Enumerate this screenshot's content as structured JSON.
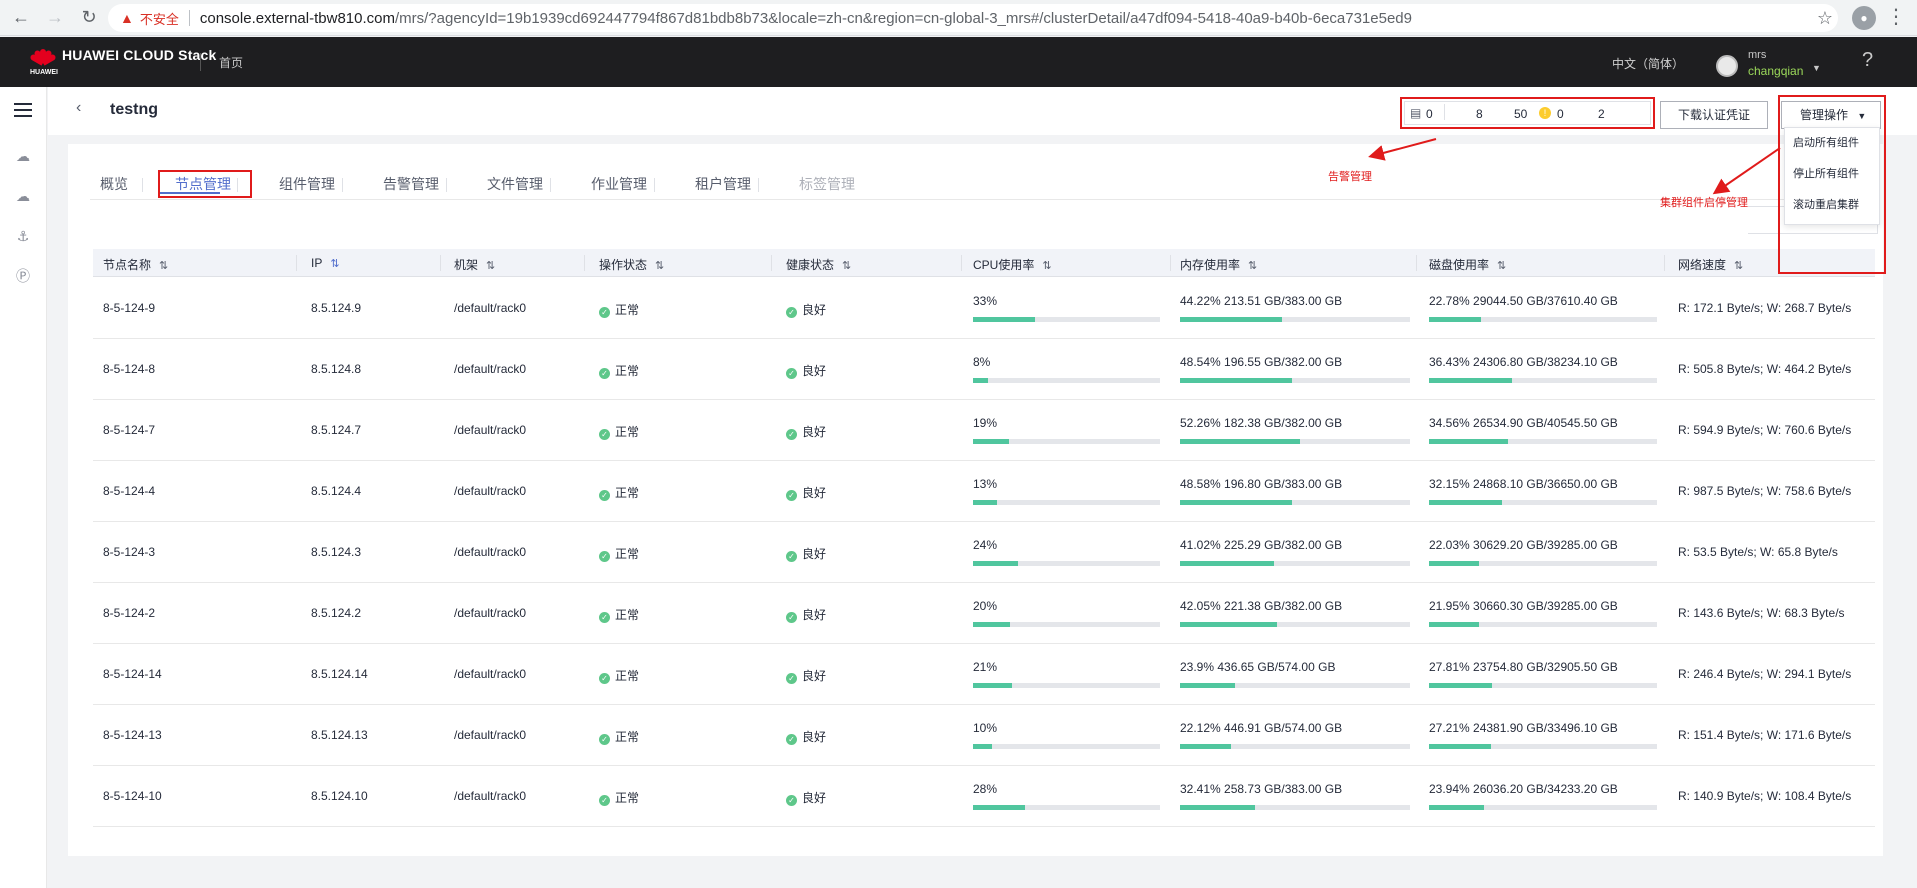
{
  "browser": {
    "warning_label": "不安全",
    "url_host": "console.external-tbw810.com",
    "url_rest": "/mrs/?agencyId=19b1939cd692447794f867d81bdb8b73&locale=zh-cn&region=cn-global-3_mrs#/clusterDetail/a47df094-5418-40a9-b40b-6eca731e5ed9"
  },
  "topnav": {
    "brand": "HUAWEI CLOUD Stack",
    "brand_sub": "HUAWEI",
    "home": "首页",
    "language": "中文（简体）",
    "user_name": "mrs",
    "user_id": "changqian",
    "help": "?"
  },
  "header": {
    "back": "‹",
    "title": "testng",
    "status": {
      "s1": "0",
      "s2": "8",
      "s3": "50",
      "s4": "0",
      "s5": "2"
    },
    "download_button": "下载认证凭证",
    "manage_button": "管理操作",
    "manage_menu": [
      "启动所有组件",
      "停止所有组件",
      "滚动重启集群"
    ]
  },
  "tabs": [
    "概览",
    "节点管理",
    "组件管理",
    "告警管理",
    "文件管理",
    "作业管理",
    "租户管理",
    "标签管理"
  ],
  "annotations": {
    "alarm": "告警管理",
    "cluster": "集群组件启停管理"
  },
  "table": {
    "columns": [
      "节点名称",
      "IP",
      "机架",
      "操作状态",
      "健康状态",
      "CPU使用率",
      "内存使用率",
      "磁盘使用率",
      "网络速度"
    ],
    "rows": [
      {
        "name": "8-5-124-9",
        "ip": "8.5.124.9",
        "rack": "/default/rack0",
        "op": "正常",
        "health": "良好",
        "cpu": "33%",
        "cpu_pct": 33,
        "mem": "44.22% 213.51 GB/383.00 GB",
        "mem_pct": 44.22,
        "disk": "22.78% 29044.50 GB/37610.40 GB",
        "disk_pct": 22.78,
        "net": "R: 172.1 Byte/s; W: 268.7 Byte/s"
      },
      {
        "name": "8-5-124-8",
        "ip": "8.5.124.8",
        "rack": "/default/rack0",
        "op": "正常",
        "health": "良好",
        "cpu": "8%",
        "cpu_pct": 8,
        "mem": "48.54% 196.55 GB/382.00 GB",
        "mem_pct": 48.54,
        "disk": "36.43% 24306.80 GB/38234.10 GB",
        "disk_pct": 36.43,
        "net": "R: 505.8 Byte/s; W: 464.2 Byte/s"
      },
      {
        "name": "8-5-124-7",
        "ip": "8.5.124.7",
        "rack": "/default/rack0",
        "op": "正常",
        "health": "良好",
        "cpu": "19%",
        "cpu_pct": 19,
        "mem": "52.26% 182.38 GB/382.00 GB",
        "mem_pct": 52.26,
        "disk": "34.56% 26534.90 GB/40545.50 GB",
        "disk_pct": 34.56,
        "net": "R: 594.9 Byte/s; W: 760.6 Byte/s"
      },
      {
        "name": "8-5-124-4",
        "ip": "8.5.124.4",
        "rack": "/default/rack0",
        "op": "正常",
        "health": "良好",
        "cpu": "13%",
        "cpu_pct": 13,
        "mem": "48.58% 196.80 GB/383.00 GB",
        "mem_pct": 48.58,
        "disk": "32.15% 24868.10 GB/36650.00 GB",
        "disk_pct": 32.15,
        "net": "R: 987.5 Byte/s; W: 758.6 Byte/s"
      },
      {
        "name": "8-5-124-3",
        "ip": "8.5.124.3",
        "rack": "/default/rack0",
        "op": "正常",
        "health": "良好",
        "cpu": "24%",
        "cpu_pct": 24,
        "mem": "41.02% 225.29 GB/382.00 GB",
        "mem_pct": 41.02,
        "disk": "22.03% 30629.20 GB/39285.00 GB",
        "disk_pct": 22.03,
        "net": "R: 53.5 Byte/s; W: 65.8 Byte/s"
      },
      {
        "name": "8-5-124-2",
        "ip": "8.5.124.2",
        "rack": "/default/rack0",
        "op": "正常",
        "health": "良好",
        "cpu": "20%",
        "cpu_pct": 20,
        "mem": "42.05% 221.38 GB/382.00 GB",
        "mem_pct": 42.05,
        "disk": "21.95% 30660.30 GB/39285.00 GB",
        "disk_pct": 21.95,
        "net": "R: 143.6 Byte/s; W: 68.3 Byte/s"
      },
      {
        "name": "8-5-124-14",
        "ip": "8.5.124.14",
        "rack": "/default/rack0",
        "op": "正常",
        "health": "良好",
        "cpu": "21%",
        "cpu_pct": 21,
        "mem": "23.9% 436.65 GB/574.00 GB",
        "mem_pct": 23.9,
        "disk": "27.81% 23754.80 GB/32905.50 GB",
        "disk_pct": 27.81,
        "net": "R: 246.4 Byte/s; W: 294.1 Byte/s"
      },
      {
        "name": "8-5-124-13",
        "ip": "8.5.124.13",
        "rack": "/default/rack0",
        "op": "正常",
        "health": "良好",
        "cpu": "10%",
        "cpu_pct": 10,
        "mem": "22.12% 446.91 GB/574.00 GB",
        "mem_pct": 22.12,
        "disk": "27.21% 24381.90 GB/33496.10 GB",
        "disk_pct": 27.21,
        "net": "R: 151.4 Byte/s; W: 171.6 Byte/s"
      },
      {
        "name": "8-5-124-10",
        "ip": "8.5.124.10",
        "rack": "/default/rack0",
        "op": "正常",
        "health": "良好",
        "cpu": "28%",
        "cpu_pct": 28,
        "mem": "32.41% 258.73 GB/383.00 GB",
        "mem_pct": 32.41,
        "disk": "23.94% 26036.20 GB/34233.20 GB",
        "disk_pct": 23.94,
        "net": "R: 140.9 Byte/s; W: 108.4 Byte/s"
      }
    ]
  }
}
